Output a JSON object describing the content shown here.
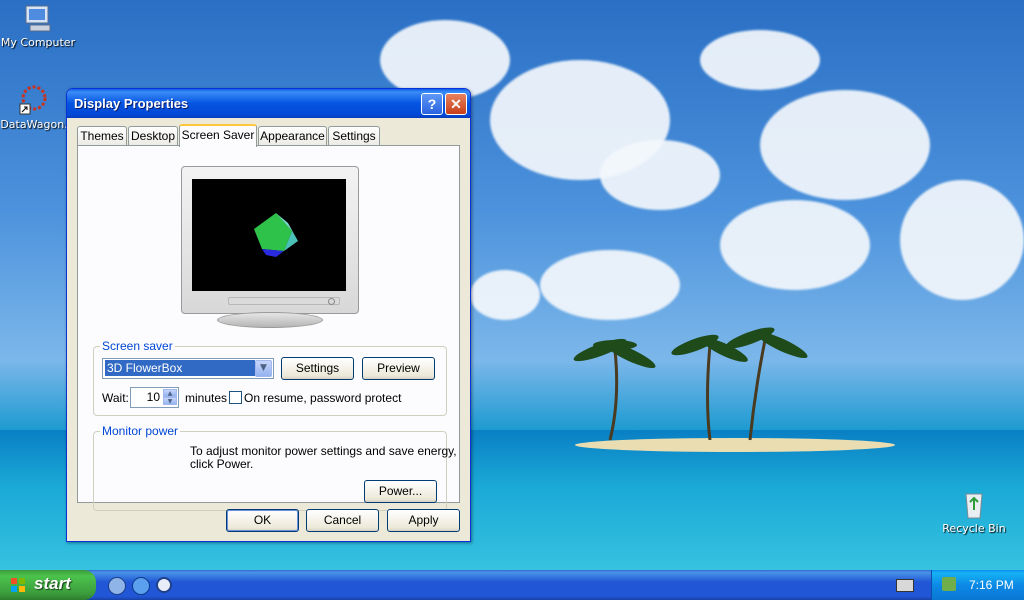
{
  "desktop": {
    "icons": [
      {
        "label": "My Computer"
      },
      {
        "label": "DataWagon."
      },
      {
        "label": "Recycle Bin"
      }
    ]
  },
  "window": {
    "title": "Display Properties",
    "help_label": "?",
    "close_label": "✕",
    "tabs": [
      "Themes",
      "Desktop",
      "Screen Saver",
      "Appearance",
      "Settings"
    ],
    "active_tab": "Screen Saver",
    "screen_saver": {
      "group_label": "Screen saver",
      "selected": "3D FlowerBox",
      "settings_button": "Settings",
      "preview_button": "Preview",
      "wait_label": "Wait:",
      "wait_value": "10",
      "minutes_label": "minutes",
      "password_label": "On resume, password protect",
      "password_checked": false
    },
    "monitor_power": {
      "group_label": "Monitor power",
      "description_line1": "To adjust monitor power settings and save energy,",
      "description_line2": "click Power.",
      "power_button": "Power..."
    },
    "footer": {
      "ok": "OK",
      "cancel": "Cancel",
      "apply": "Apply"
    }
  },
  "taskbar": {
    "start_label": "start",
    "clock": "7:16 PM"
  },
  "colors": {
    "title_bar": "#0554e2",
    "group_label": "#0046d5",
    "selection": "#316ac5",
    "start_green": "#3c9a3c",
    "taskbar_blue": "#2157d7"
  }
}
